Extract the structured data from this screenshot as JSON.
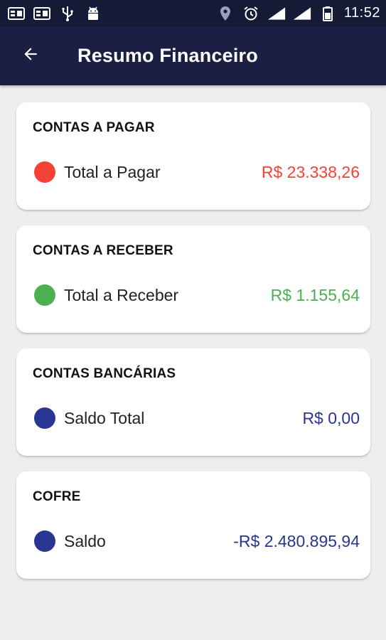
{
  "status_bar": {
    "left_icons": [
      "notification-card-icon",
      "notification-card-2-icon",
      "usb-icon",
      "android-debug-icon"
    ],
    "right_icons": [
      "location-icon",
      "alarm-icon",
      "signal-1-icon",
      "signal-2-icon",
      "battery-icon"
    ],
    "time": "11:52"
  },
  "app_bar": {
    "back_icon": "arrow-left-icon",
    "title": "Resumo Financeiro"
  },
  "cards": [
    {
      "title": "CONTAS A PAGAR",
      "label": "Total a Pagar",
      "value": "R$ 23.338,26",
      "color": "#f44336"
    },
    {
      "title": "CONTAS A RECEBER",
      "label": "Total a Receber",
      "value": "R$ 1.155,64",
      "color": "#4caf50"
    },
    {
      "title": "CONTAS BANCÁRIAS",
      "label": "Saldo Total",
      "value": "R$ 0,00",
      "color": "#283593"
    },
    {
      "title": "COFRE",
      "label": "Saldo",
      "value": "-R$ 2.480.895,94",
      "color": "#283593"
    }
  ]
}
